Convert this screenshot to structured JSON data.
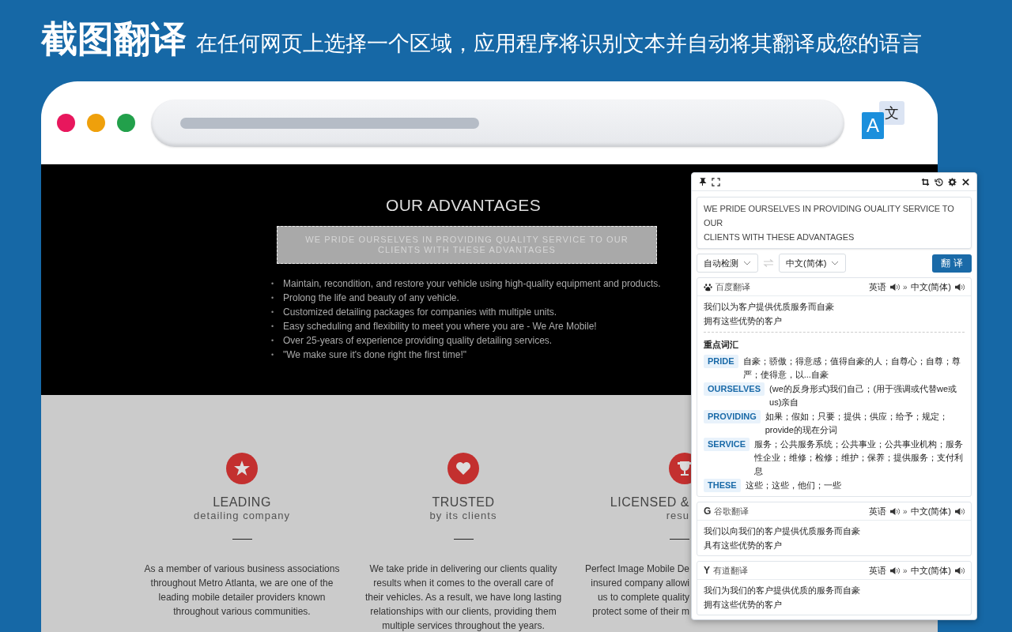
{
  "banner": {
    "title": "截图翻译",
    "subtitle": "在任何网页上选择一个区域，应用程序将识别文本并自动将其翻译成您的语言"
  },
  "browser": {
    "extension_icon": {
      "front": "A",
      "back": "文"
    }
  },
  "page": {
    "heading": "OUR ADVANTAGES",
    "selected_text": [
      "WE PRIDE OURSELVES IN PROVIDING QUALITY SERVICE TO OUR",
      "CLIENTS WITH THESE ADVANTAGES"
    ],
    "bullet_marker": "•",
    "bullets": [
      "Maintain, recondition, and restore your vehicle using high-quality equipment and products.",
      "Prolong the life and beauty of any vehicle.",
      "Customized detailing packages for companies with multiple units.",
      "Easy scheduling and flexibility to meet you where you are - We Are Mobile!",
      "Over 25-years of experience providing quality detailing services.",
      "\"We make sure it's done right the first time!\""
    ],
    "features": [
      {
        "kind": "star",
        "title": "LEADING",
        "subtitle": "detailing company",
        "lines": [
          "As a member of various business associations",
          "throughout Metro Atlanta, we are one of the",
          "leading mobile detailer providers known",
          "throughout various communities."
        ]
      },
      {
        "kind": "heart",
        "title": "TRUSTED",
        "subtitle": "by its clients",
        "lines": [
          "We take pride in delivering our clients quality",
          "results when it comes to the overall care of",
          "their vehicles. As a result, we have long lasting",
          "relationships with our clients, providing them",
          "multiple services throughout the years."
        ]
      },
      {
        "kind": "trophy",
        "title": "LICENSED &",
        "subtitle": "resu",
        "lines": [
          "Perfect Image Mobile De",
          "insured company allowi",
          "us to complete quality",
          "protect some of their m"
        ]
      }
    ]
  },
  "popup": {
    "source_text": "WE PRIDE OURSELVES IN PROVIDING OUALITY SERVICE TO OUR\nCLIENTS WITH THESE ADVANTAGES",
    "source_lang": "自动检测",
    "target_lang": "中文(简体)",
    "translate_button": "翻 译",
    "results": [
      {
        "kind": "baidu",
        "name": "百度翻译",
        "from": "英语",
        "sep": "»",
        "to": "中文(简体)",
        "lines": [
          "我们以为客户提供优质服务而自豪",
          "拥有这些优势的客户"
        ],
        "vocab_title": "重点词汇",
        "vocab": [
          {
            "word": "PRIDE",
            "meaning": "自豪；骄傲；得意感；值得自豪的人；自尊心；自尊；尊严；使得意，以...自豪"
          },
          {
            "word": "OURSELVES",
            "meaning": "(we的反身形式)我们自己；(用于强调或代替we或us)亲自"
          },
          {
            "word": "PROVIDING",
            "meaning": "如果；假如；只要；提供；供应；给予；规定；provide的现在分词"
          },
          {
            "word": "SERVICE",
            "meaning": "服务；公共服务系统；公共事业；公共事业机构；服务性企业；维修；检修；维护；保养；提供服务；支付利息"
          },
          {
            "word": "THESE",
            "meaning": "这些；这些，他们；一些"
          }
        ]
      },
      {
        "kind": "google",
        "icon_char": "G",
        "name": "谷歌翻译",
        "from": "英语",
        "sep": "»",
        "to": "中文(简体)",
        "lines": [
          "我们以向我们的客户提供优质服务而自豪",
          "具有这些优势的客户"
        ]
      },
      {
        "kind": "youdao",
        "icon_char": "Y",
        "name": "有道翻译",
        "from": "英语",
        "sep": "»",
        "to": "中文(简体)",
        "lines": [
          "我们为我们的客户提供优质的服务而自豪",
          "拥有这些优势的客户"
        ]
      }
    ]
  }
}
